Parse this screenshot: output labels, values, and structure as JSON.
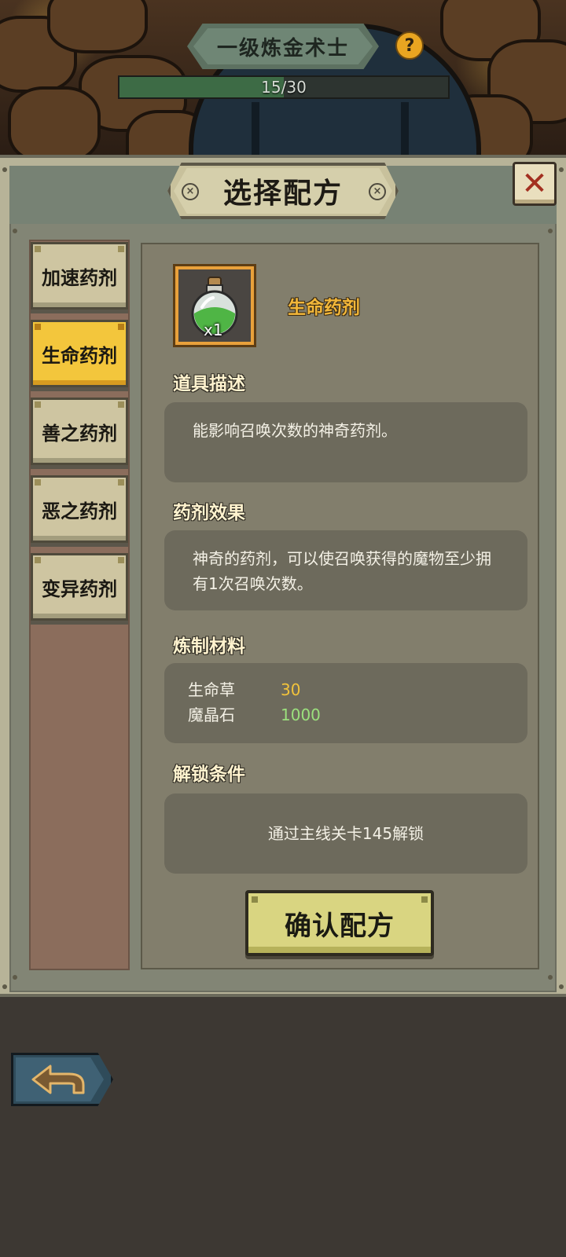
{
  "header": {
    "level_title": "一级炼金术士",
    "help_icon": "question-icon",
    "progress_text": "15/30",
    "progress_fraction": 0.5
  },
  "dialog": {
    "title": "选择配方",
    "close_icon": "close-icon",
    "recipes": [
      {
        "label": "加速药剂",
        "active": false
      },
      {
        "label": "生命药剂",
        "active": true
      },
      {
        "label": "善之药剂",
        "active": false
      },
      {
        "label": "恶之药剂",
        "active": false
      },
      {
        "label": "变异药剂",
        "active": false
      }
    ],
    "detail": {
      "item_icon": "potion-icon",
      "item_qty": "x1",
      "item_name": "生命药剂",
      "description_title": "道具描述",
      "description": "能影响召唤次数的神奇药剂。",
      "effect_title": "药剂效果",
      "effect": "神奇的药剂，可以使召唤获得的魔物至少拥有1次召唤次数。",
      "materials_title": "炼制材料",
      "materials": [
        {
          "name": "生命草",
          "amount": "30",
          "color": "#f2c33b"
        },
        {
          "name": "魔晶石",
          "amount": "1000",
          "color": "#9be07d"
        }
      ],
      "unlock_title": "解锁条件",
      "unlock": "通过主线关卡145解锁",
      "confirm_label": "确认配方"
    }
  },
  "footer": {
    "back_icon": "back-arrow-icon"
  }
}
